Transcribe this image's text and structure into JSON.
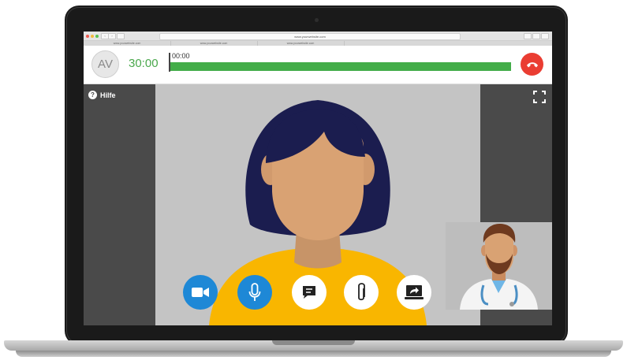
{
  "browser": {
    "url": "www.yourwebsite.com",
    "tabs": [
      "www.yourwebsite.com",
      "www.yourwebsite.com",
      "www.yourwebsite.com"
    ]
  },
  "call": {
    "avatar_initials": "AV",
    "remaining_time": "30:00",
    "elapsed_time": "00:00",
    "progress_fraction": 1.0,
    "progress_color": "#43ad49",
    "hangup_color": "#ea3d32"
  },
  "overlay": {
    "help_label": "Hilfe",
    "help_icon": "question-circle-icon",
    "fullscreen_icon": "fullscreen-icon"
  },
  "controls": [
    {
      "name": "camera",
      "icon": "video-camera-icon",
      "active": true
    },
    {
      "name": "microphone",
      "icon": "microphone-icon",
      "active": true
    },
    {
      "name": "chat",
      "icon": "chat-icon",
      "active": false
    },
    {
      "name": "attachment",
      "icon": "paperclip-icon",
      "active": false
    },
    {
      "name": "share-screen",
      "icon": "share-screen-icon",
      "active": false
    }
  ],
  "colors": {
    "accent_blue": "#1e88d6",
    "video_dark": "#4a4a4a",
    "video_light": "#c4c4c4"
  }
}
